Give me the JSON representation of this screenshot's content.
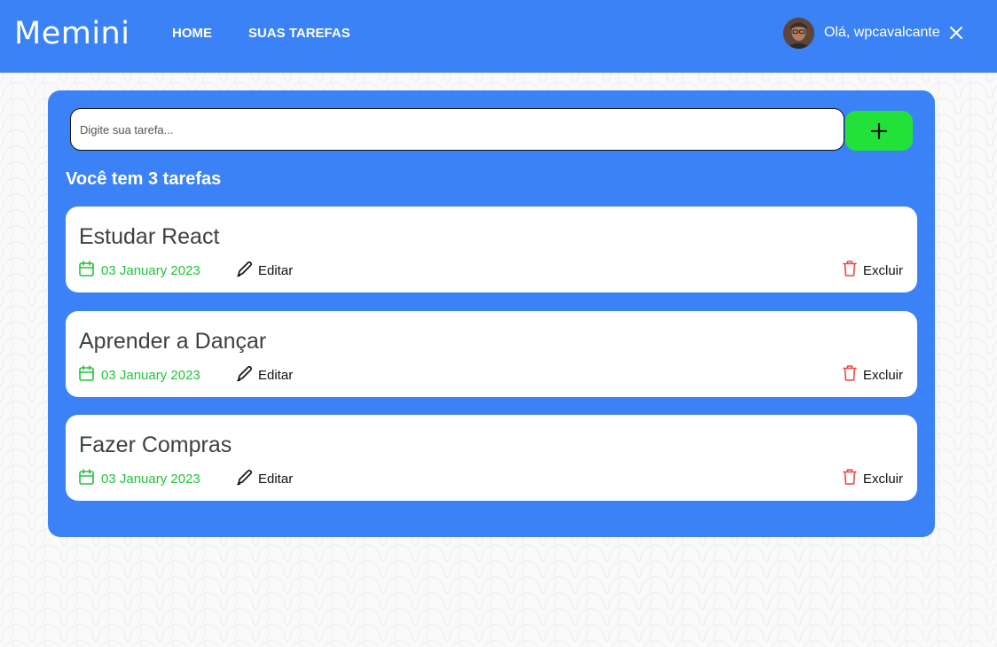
{
  "app": {
    "name": "Memini"
  },
  "nav": {
    "items": [
      {
        "label": "HOME"
      },
      {
        "label": "SUAS TAREFAS"
      }
    ]
  },
  "user": {
    "greeting": "Olá, wpcavalcante"
  },
  "new_task": {
    "placeholder": "Digite sua tarefa...",
    "value": ""
  },
  "tasks_header": "Você tem 3 tarefas",
  "tasks": [
    {
      "title": "Estudar React",
      "date": "03 January 2023",
      "edit_label": "Editar",
      "delete_label": "Excluir"
    },
    {
      "title": "Aprender a Dançar",
      "date": "03 January 2023",
      "edit_label": "Editar",
      "delete_label": "Excluir"
    },
    {
      "title": "Fazer Compras",
      "date": "03 January 2023",
      "edit_label": "Editar",
      "delete_label": "Excluir"
    }
  ],
  "icons": {
    "logout": "close-icon",
    "add": "plus-icon",
    "date": "calendar-icon",
    "edit": "pencil-icon",
    "delete": "trash-icon"
  },
  "colors": {
    "primary": "#3b82f6",
    "add_button": "#22e23a",
    "date_text": "#22c33a",
    "delete_icon": "#ef4444"
  }
}
